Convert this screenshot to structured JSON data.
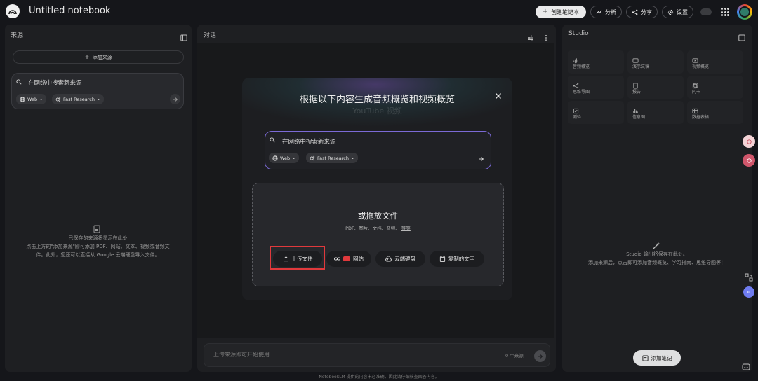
{
  "app": {
    "title": "Untitled notebook"
  },
  "header": {
    "create_label": "创建笔记本",
    "analytics_label": "分析",
    "share_label": "分享",
    "settings_label": "设置"
  },
  "sources": {
    "title": "来源",
    "add_label": "添加来源",
    "search_placeholder": "在网络中搜索新来源",
    "web_chip": "Web",
    "research_chip": "Fast Research",
    "empty_title": "已保存的来源将显示在此处",
    "empty_line1": "点击上方的\"添加来源\"即可添加 PDF、网站、文本、视频或音频文",
    "empty_line2": "件。此外，您还可以直接从 Google 云端硬盘导入文件。"
  },
  "chat": {
    "title": "对话",
    "input_placeholder": "上传来源即可开始使用",
    "source_count": "0 个来源"
  },
  "modal": {
    "title": "根据以下内容生成音频概览和视频概览",
    "ghost_text": "YouTube 视频",
    "search_placeholder": "在网络中搜索新来源",
    "web_chip": "Web",
    "research_chip": "Fast Research",
    "drop_title": "或拖放文件",
    "drop_types": "PDF、图片、文档、音频、",
    "drop_more": "等等",
    "upload_label": "上传文件",
    "website_label": "网站",
    "drive_label": "云端硬盘",
    "paste_label": "复制的文字"
  },
  "studio": {
    "title": "Studio",
    "items": [
      {
        "label": "音频概览",
        "icon": "audio-icon"
      },
      {
        "label": "演示文稿",
        "icon": "slides-icon"
      },
      {
        "label": "视频概览",
        "icon": "video-icon"
      },
      {
        "label": "思维导图",
        "icon": "mindmap-icon"
      },
      {
        "label": "报告",
        "icon": "report-icon"
      },
      {
        "label": "闪卡",
        "icon": "flashcard-icon"
      },
      {
        "label": "测验",
        "icon": "quiz-icon"
      },
      {
        "label": "信息图",
        "icon": "chart-icon"
      },
      {
        "label": "数据表格",
        "icon": "table-icon"
      }
    ],
    "empty_title": "Studio 输出将保存在此处。",
    "empty_desc": "添加来源后，点击即可添加音频概览、学习指南、思维导图等！",
    "add_note_label": "添加笔记"
  },
  "footer": {
    "text": "NotebookLM 提供的内容未必准确，因此请仔细核查回答内容。"
  },
  "colors": {
    "background": "#15161a",
    "panel": "#1e1f22",
    "accent_red": "#e0393c",
    "accent_purple": "#7b6ad6"
  }
}
